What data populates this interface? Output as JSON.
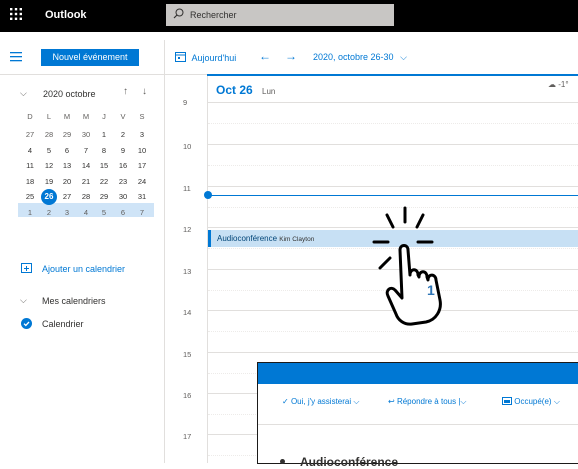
{
  "app": {
    "waffle_icon": "waffle-icon",
    "title": "Outlook"
  },
  "search": {
    "placeholder": "Rechercher"
  },
  "toolbar": {
    "new_event_label": "Nouvel événement",
    "today_label": "Aujourd'hui",
    "date_range": "2020, octobre 26-30"
  },
  "mini_calendar": {
    "month_label": "2020 octobre",
    "weekday_headers": [
      "D",
      "L",
      "M",
      "M",
      "J",
      "V",
      "S"
    ],
    "weeks": [
      [
        "27",
        "28",
        "29",
        "30",
        "1",
        "2",
        "3"
      ],
      [
        "4",
        "5",
        "6",
        "7",
        "8",
        "9",
        "10"
      ],
      [
        "11",
        "12",
        "13",
        "14",
        "15",
        "16",
        "17"
      ],
      [
        "18",
        "19",
        "20",
        "21",
        "22",
        "23",
        "24"
      ],
      [
        "25",
        "26",
        "27",
        "28",
        "29",
        "30",
        "31"
      ],
      [
        "1",
        "2",
        "3",
        "4",
        "5",
        "6",
        "7"
      ]
    ],
    "selected_day": "26"
  },
  "left_nav": {
    "add_calendar": "Ajouter un calendrier",
    "my_calendars": "Mes calendriers",
    "calendar_item": "Calendrier"
  },
  "day_view": {
    "date_label": "Oct 26",
    "day_of_week": "Lun",
    "weather": "-1°",
    "hours": [
      "9",
      "10",
      "11",
      "12",
      "13",
      "14",
      "15",
      "16",
      "17"
    ]
  },
  "event": {
    "title": "Audioconférence",
    "organizer": "Kim Clayton"
  },
  "popup": {
    "accept_label": "Oui, j'y assisterai",
    "reply_all_label": "Répondre à tous",
    "busy_label": "Occupé(e)",
    "title": "Audioconférence"
  },
  "annotation": {
    "step_number": "1"
  },
  "colors": {
    "accent": "#0078d4",
    "top_bar": "#000000",
    "event_fill": "#c7e0f4"
  }
}
